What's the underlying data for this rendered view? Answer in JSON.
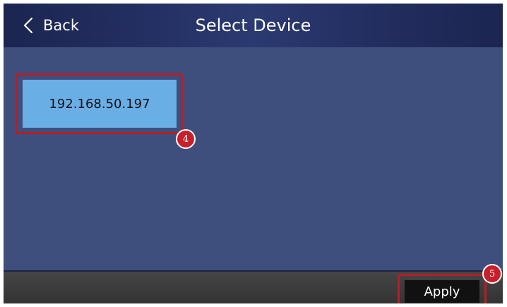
{
  "header": {
    "back_label": "Back",
    "title": "Select Device",
    "back_icon": "chevron-left-icon"
  },
  "devices": [
    {
      "label": "192.168.50.197",
      "selected": true
    }
  ],
  "footer": {
    "apply_label": "Apply"
  },
  "annotations": {
    "device_step": "4",
    "apply_step": "5"
  },
  "colors": {
    "header_bg": "#243063",
    "content_bg": "#3e4f7e",
    "device_bg": "#6aaee6",
    "highlight": "#b51f25",
    "footer_bg": "#3c3c3c",
    "apply_bg": "#111111"
  }
}
